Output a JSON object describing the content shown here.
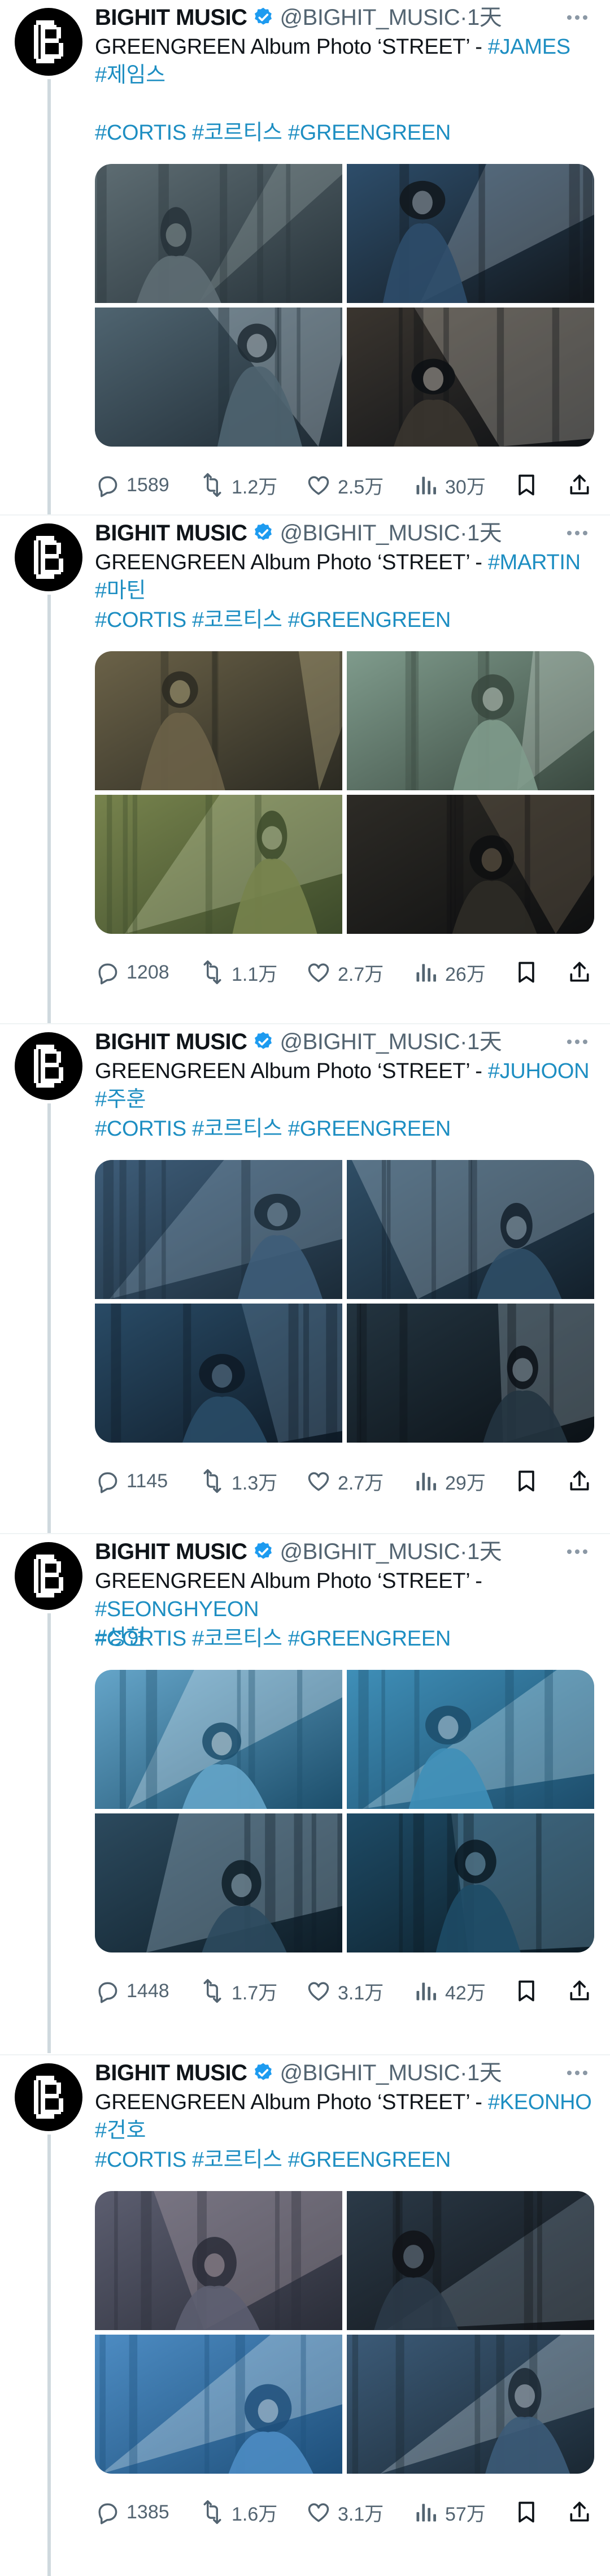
{
  "account": {
    "name": "BIGHIT MUSIC",
    "handle": "@BIGHIT_MUSIC",
    "separator": "·",
    "time": "1天"
  },
  "colors": {
    "link": "#1d8ec2",
    "muted": "#536471",
    "verified": "#1d9bf0"
  },
  "tweets": [
    {
      "text": "GREENGREEN Album Photo ‘STREET’ - ",
      "member_en": "#JAMES",
      "member_ko": "#제임스",
      "tag1": "#CORTIS",
      "tag2": "#코르티스",
      "tag3": "#GREENGREEN",
      "replies": "1589",
      "reposts": "1.2万",
      "likes": "2.5万",
      "views": "30万"
    },
    {
      "text": "GREENGREEN Album Photo ‘STREET’ - ",
      "member_en": "#MARTIN",
      "member_ko": "#마틴",
      "tag1": "#CORTIS",
      "tag2": "#코르티스",
      "tag3": "#GREENGREEN",
      "replies": "1208",
      "reposts": "1.1万",
      "likes": "2.7万",
      "views": "26万"
    },
    {
      "text": "GREENGREEN Album Photo ‘STREET’ - ",
      "member_en": "#JUHOON",
      "member_ko": "#주훈",
      "tag1": "#CORTIS",
      "tag2": "#코르티스",
      "tag3": "#GREENGREEN",
      "replies": "1145",
      "reposts": "1.3万",
      "likes": "2.7万",
      "views": "29万"
    },
    {
      "text": "GREENGREEN Album Photo ‘STREET’ - ",
      "member_en": "#SEONGHYEON",
      "member_ko": "#성현",
      "tag1": "#CORTIS",
      "tag2": "#코르티스",
      "tag3": "#GREENGREEN",
      "replies": "1448",
      "reposts": "1.7万",
      "likes": "3.1万",
      "views": "42万"
    },
    {
      "text": "GREENGREEN Album Photo ‘STREET’ - ",
      "member_en": "#KEONHO",
      "member_ko": "#건호",
      "tag1": "#CORTIS",
      "tag2": "#코르티스",
      "tag3": "#GREENGREEN",
      "replies": "1385",
      "reposts": "1.6万",
      "likes": "3.1万",
      "views": "57万"
    }
  ],
  "icons": {
    "reply": "reply-icon",
    "repost": "repost-icon",
    "like": "heart-icon",
    "views": "views-icon",
    "bookmark": "bookmark-icon",
    "share": "share-icon",
    "more": "more-icon",
    "verified": "verified-badge-icon"
  }
}
